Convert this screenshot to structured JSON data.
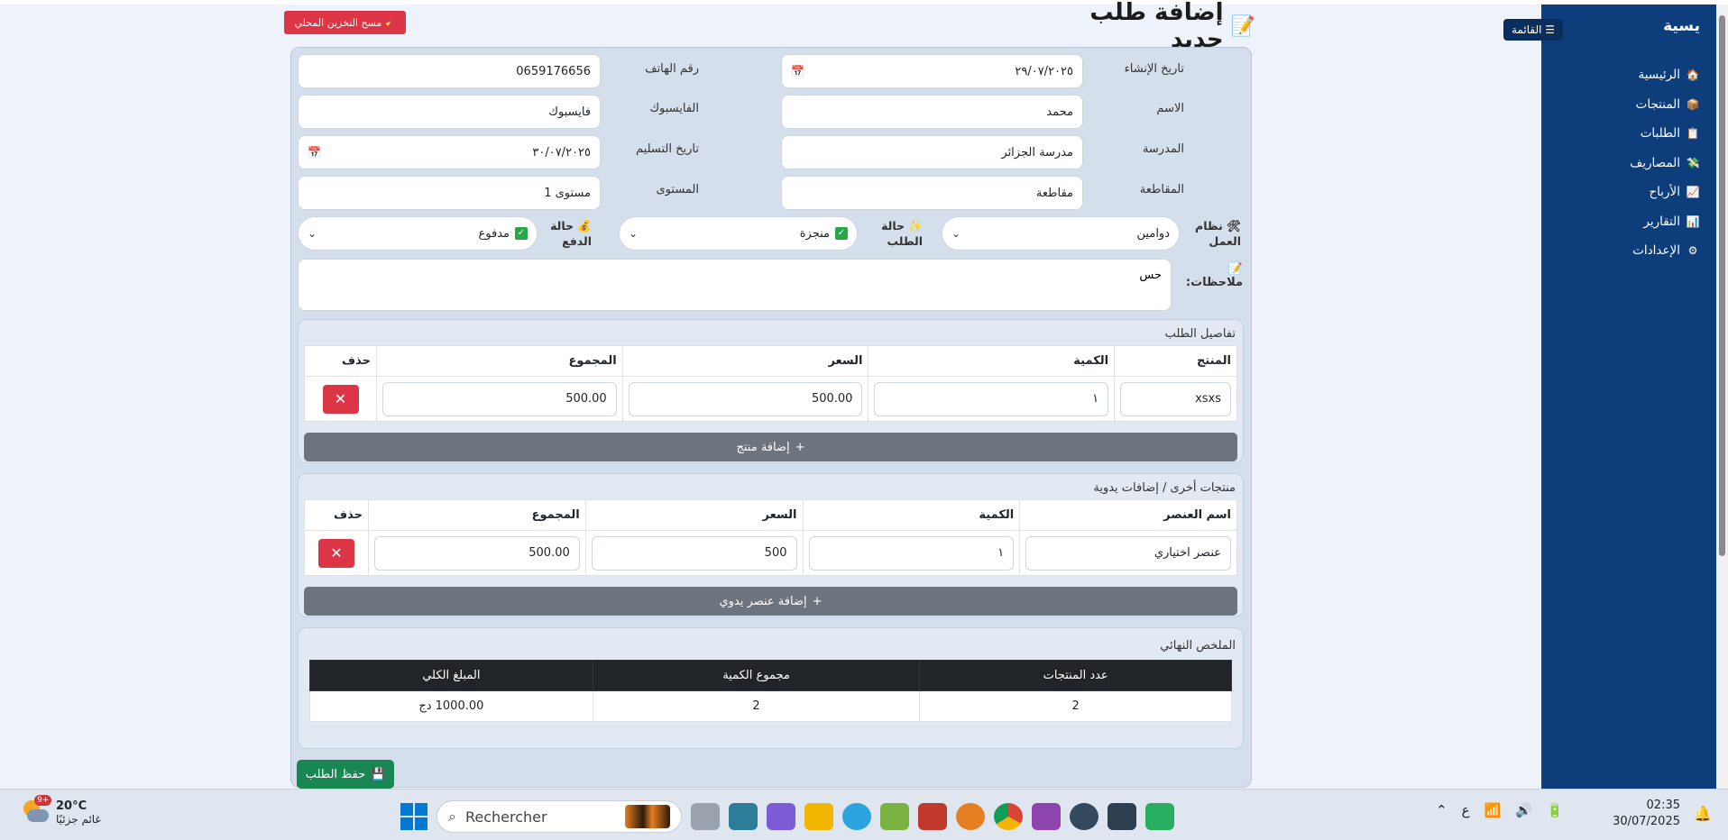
{
  "app": {
    "title": "إضافة طلب جديد",
    "clear_storage_label": "مسح التخزين المحلي",
    "save_label": "حفظ الطلب"
  },
  "sidebar": {
    "title": "يسية",
    "menu_label": "☰ القائمة",
    "items": [
      {
        "label": "الرئيسية",
        "icon": "home-icon"
      },
      {
        "label": "المنتجات",
        "icon": "box-icon"
      },
      {
        "label": "الطلبات",
        "icon": "clipboard-icon"
      },
      {
        "label": "المصاريف",
        "icon": "money-icon"
      },
      {
        "label": "الأرباح",
        "icon": "chart-icon"
      },
      {
        "label": "التقارير",
        "icon": "bar-chart-icon"
      },
      {
        "label": "الإعدادات",
        "icon": "gear-icon"
      }
    ]
  },
  "form": {
    "created_date": {
      "label": "تاريخ الإنشاء",
      "value": "٢٩/٠٧/٢٠٢٥"
    },
    "phone": {
      "label": "رقم الهاتف",
      "value": "0659176656"
    },
    "name": {
      "label": "الاسم",
      "value": "محمد"
    },
    "facebook": {
      "label": "الفايسبوك",
      "value": "فايسبوك"
    },
    "school": {
      "label": "المدرسة",
      "value": "مدرسة الجزائر"
    },
    "delivery_date": {
      "label": "تاريخ التسليم",
      "value": "٣٠/٠٧/٢٠٢٥"
    },
    "province": {
      "label": "المقاطعة",
      "value": "مقاطعة"
    },
    "level": {
      "label": "المستوى",
      "value": "مستوى 1"
    },
    "work_system": {
      "label_1": "نظام",
      "label_2": "العمل",
      "value": "دوامين"
    },
    "order_status": {
      "label_1": "حالة",
      "label_2": "الطلب",
      "value": "منجزة"
    },
    "payment_status": {
      "label_1": "حالة",
      "label_2": "الدفع",
      "value": "مدفوع"
    },
    "notes": {
      "label": "ملاحظات:",
      "value": "حس"
    }
  },
  "order_details": {
    "title": "تفاصيل الطلب",
    "headers": [
      "المنتج",
      "الكمية",
      "السعر",
      "المجموع",
      "حذف"
    ],
    "rows": [
      {
        "product": "xsxs",
        "quantity": "١",
        "price": "500.00",
        "total": "500.00"
      }
    ],
    "add_label": "إضافة منتج"
  },
  "manual_items": {
    "title": "منتجات أخرى / إضافات يدوية",
    "headers": [
      "اسم العنصر",
      "الكمية",
      "السعر",
      "المجموع",
      "حذف"
    ],
    "rows": [
      {
        "name": "عنصر اختياري",
        "quantity": "١",
        "price": "500",
        "total": "500.00"
      }
    ],
    "add_label": "إضافة عنصر يدوي"
  },
  "summary": {
    "title": "الملخص النهائي",
    "headers": [
      "عدد المنتجات",
      "مجموع الكمية",
      "المبلغ الكلي"
    ],
    "values": [
      "2",
      "2",
      "1000.00 دج"
    ]
  },
  "taskbar": {
    "weather_temp": "20°C",
    "weather_desc": "غائم جزئيًا",
    "weather_badge": "9+",
    "search_placeholder": "Rechercher",
    "lang": "ع",
    "time": "02:35",
    "date": "30/07/2025"
  },
  "colors": {
    "sidebar": "#0d3d7a",
    "danger": "#dc3545",
    "success": "#198754",
    "secondary": "#6c757d"
  }
}
